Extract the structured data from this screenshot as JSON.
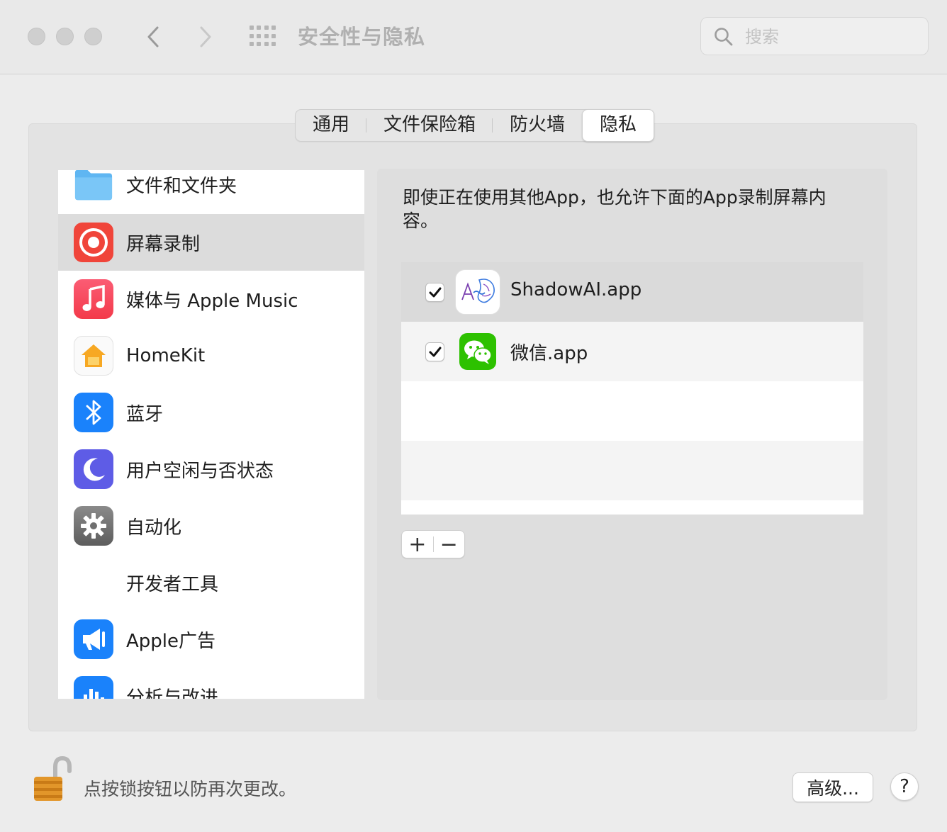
{
  "window": {
    "title": "安全性与隐私",
    "search_placeholder": "搜索"
  },
  "tabs": [
    {
      "label": "通用",
      "active": false
    },
    {
      "label": "文件保险箱",
      "active": false
    },
    {
      "label": "防火墙",
      "active": false
    },
    {
      "label": "隐私",
      "active": true
    }
  ],
  "sidebar": {
    "items": [
      {
        "label": "文件和文件夹",
        "icon": "folder-icon",
        "selected": false
      },
      {
        "label": "屏幕录制",
        "icon": "screen-recording-icon",
        "selected": true
      },
      {
        "label": "媒体与 Apple Music",
        "icon": "music-icon",
        "selected": false
      },
      {
        "label": "HomeKit",
        "icon": "home-icon",
        "selected": false
      },
      {
        "label": "蓝牙",
        "icon": "bluetooth-icon",
        "selected": false
      },
      {
        "label": "用户空闲与否状态",
        "icon": "moon-icon",
        "selected": false
      },
      {
        "label": "自动化",
        "icon": "gear-icon",
        "selected": false
      },
      {
        "label": "开发者工具",
        "icon": "",
        "selected": false
      },
      {
        "label": "Apple广告",
        "icon": "megaphone-icon",
        "selected": false
      },
      {
        "label": "分析与改进",
        "icon": "chart-icon",
        "selected": false
      }
    ]
  },
  "main": {
    "description": "即使正在使用其他App，也允许下面的App录制屏幕内容。",
    "apps": [
      {
        "name": "ShadowAI.app",
        "checked": true,
        "icon": "shadowai-icon"
      },
      {
        "name": "微信.app",
        "checked": true,
        "icon": "wechat-icon"
      }
    ],
    "add_label": "+",
    "remove_label": "−"
  },
  "footer": {
    "lock_text": "点按锁按钮以防再次更改。",
    "advanced_label": "高级...",
    "help_label": "?"
  },
  "colors": {
    "wechat_green": "#2dc100",
    "screen_record_red": "#f0453a",
    "music_red": "#fa3b4f",
    "bluetooth_blue": "#1a82fb",
    "moon_purple": "#5e5ce6"
  }
}
